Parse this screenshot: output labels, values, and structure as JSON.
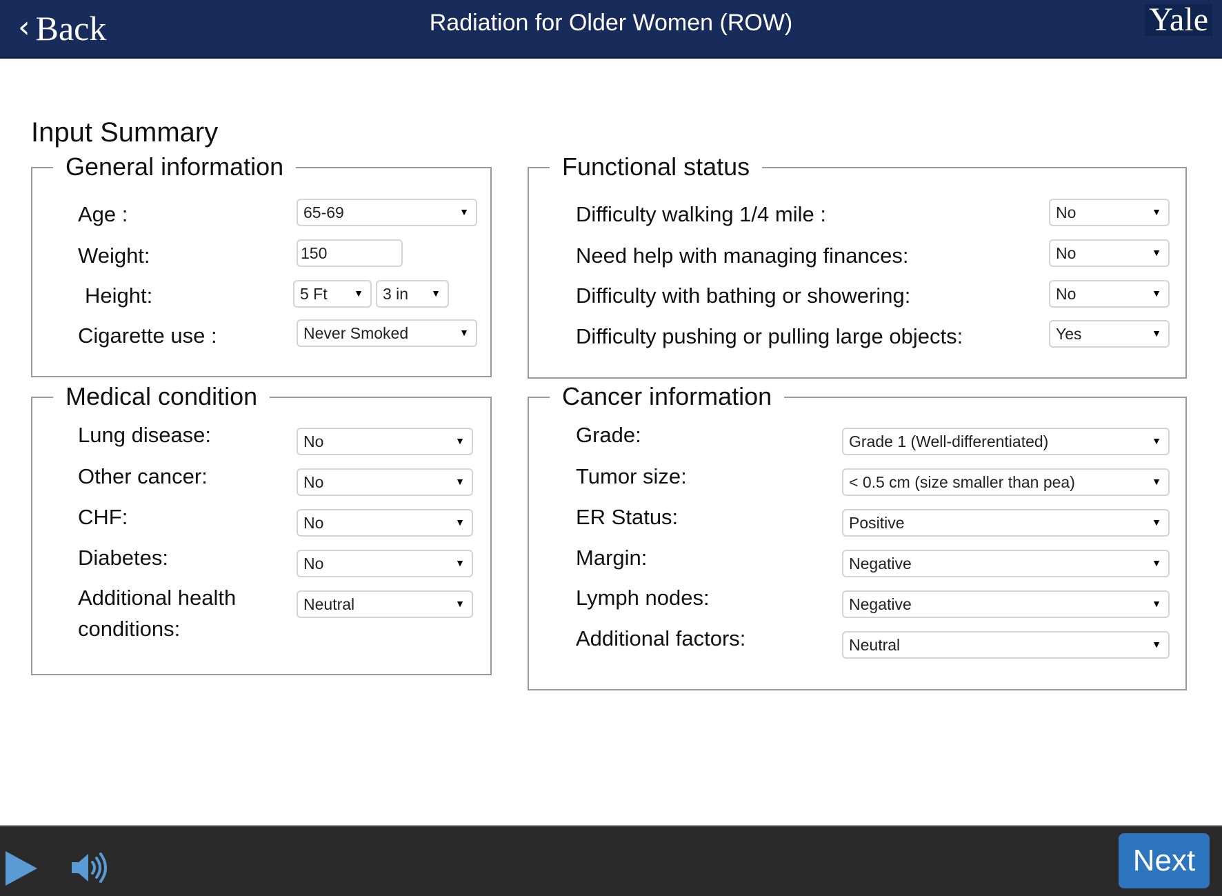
{
  "header": {
    "back_label": "Back",
    "back_icon": "chevron-left-icon",
    "title": "Radiation for Older Women (ROW)",
    "logo_text": "Yale",
    "bg_color": "#172c5b"
  },
  "page_title": "Input Summary",
  "general_information": {
    "legend": "General information",
    "age": {
      "label": "Age :",
      "value": "65-69"
    },
    "weight": {
      "label": "Weight:",
      "value": "150"
    },
    "height": {
      "label": "Height:",
      "feet": "5 Ft",
      "inches": "3 in"
    },
    "cigarette_use": {
      "label": "Cigarette use :",
      "value": "Never Smoked"
    }
  },
  "functional_status": {
    "legend": "Functional status",
    "items": [
      {
        "label": "Difficulty walking 1/4 mile :",
        "value": "No"
      },
      {
        "label": "Need help with managing finances:",
        "value": "No"
      },
      {
        "label": "Difficulty with bathing or showering:",
        "value": "No"
      },
      {
        "label": "Difficulty pushing or pulling large objects:",
        "value": "Yes"
      }
    ]
  },
  "medical_condition": {
    "legend": "Medical condition",
    "items": [
      {
        "label": "Lung disease:",
        "value": "No"
      },
      {
        "label": "Other cancer:",
        "value": "No"
      },
      {
        "label": "CHF:",
        "value": "No"
      },
      {
        "label": "Diabetes:",
        "value": "No"
      },
      {
        "label": "Additional health",
        "label2": "conditions:",
        "value": "Neutral"
      }
    ]
  },
  "cancer_information": {
    "legend": "Cancer information",
    "items": [
      {
        "label": "Grade:",
        "value": "Grade 1 (Well-differentiated)"
      },
      {
        "label": "Tumor size:",
        "value": "< 0.5 cm (size smaller than pea)"
      },
      {
        "label": "ER Status:",
        "value": "Positive"
      },
      {
        "label": "Margin:",
        "value": "Negative"
      },
      {
        "label": "Lymph nodes:",
        "value": "Negative"
      },
      {
        "label": "Additional factors:",
        "value": "Neutral"
      }
    ]
  },
  "footer": {
    "play_icon": "play-icon",
    "volume_icon": "volume-icon",
    "next_label": "Next",
    "accent_color": "#2e75c0"
  },
  "dropdown_arrow": "▼"
}
